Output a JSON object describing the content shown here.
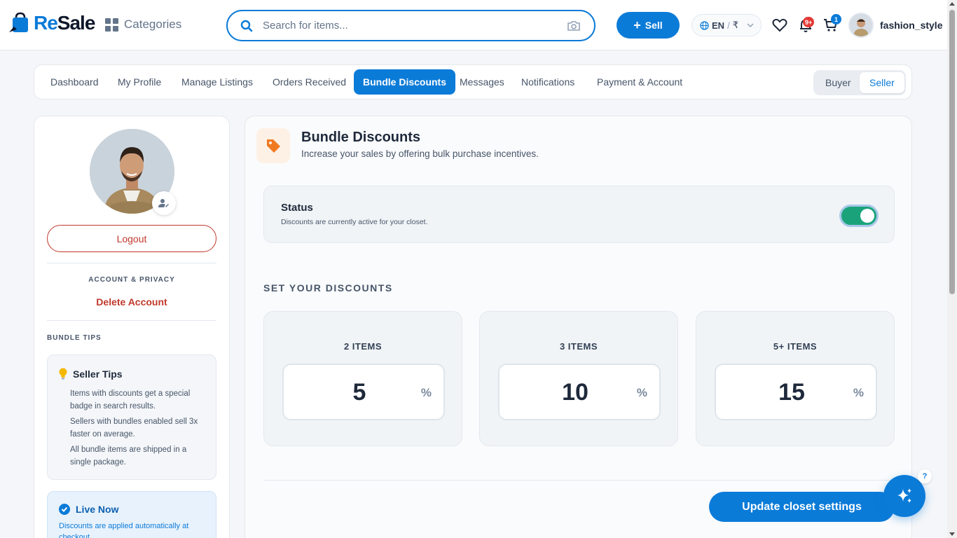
{
  "brand": {
    "name_part1": "Re",
    "name_part2": "Sale",
    "accent": "#0b7bd8"
  },
  "header": {
    "categories_label": "Categories",
    "search_placeholder": "Search for items...",
    "sell_label": "Sell",
    "lang": "EN",
    "currency": "₹",
    "notifications_badge": "9+",
    "cart_badge": "1",
    "username": "fashion_style"
  },
  "tabs": [
    {
      "label": "Dashboard",
      "active": false
    },
    {
      "label": "My Profile",
      "active": false
    },
    {
      "label": "Manage Listings",
      "active": false
    },
    {
      "label": "Orders Received",
      "active": false
    },
    {
      "label": "Bundle Discounts",
      "active": true
    },
    {
      "label": "Messages",
      "active": false
    },
    {
      "label": "Notifications",
      "active": false
    },
    {
      "label": "Payment & Account",
      "active": false
    }
  ],
  "role_toggle": {
    "buyer": "Buyer",
    "seller": "Seller",
    "selected": "Seller"
  },
  "sidebar": {
    "logout": "Logout",
    "account_privacy_label": "ACCOUNT & PRIVACY",
    "delete_account": "Delete Account",
    "bundle_tips_label": "BUNDLE TIPS",
    "tips": {
      "title": "Seller Tips",
      "items": [
        "Items with discounts get a special badge in search results.",
        "Sellers with bundles enabled sell 3x faster on average.",
        "All bundle items are shipped in a single package."
      ]
    },
    "live": {
      "title": "Live Now",
      "text": "Discounts are applied automatically at checkout."
    }
  },
  "main": {
    "title": "Bundle Discounts",
    "subtitle": "Increase your sales by offering bulk purchase incentives.",
    "status": {
      "title": "Status",
      "description": "Discounts are currently active for your closet.",
      "enabled": true
    },
    "set_label": "SET YOUR DISCOUNTS",
    "discounts": [
      {
        "label": "2 ITEMS",
        "value": "5",
        "unit": "%"
      },
      {
        "label": "3 ITEMS",
        "value": "10",
        "unit": "%"
      },
      {
        "label": "5+ ITEMS",
        "value": "15",
        "unit": "%"
      }
    ],
    "update_button": "Update closet settings"
  },
  "fab": {
    "help_label": "?"
  },
  "colors": {
    "primary": "#0b7bd8",
    "danger": "#c0392b",
    "toggle_on": "#1aa37a",
    "tag_orange": "#f07a22"
  }
}
